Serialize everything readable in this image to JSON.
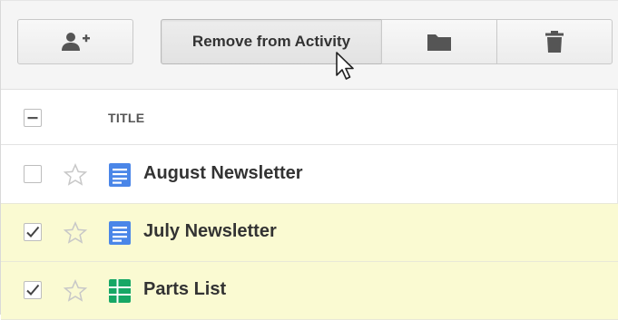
{
  "toolbar": {
    "share_icon": "person-add-icon",
    "remove_label": "Remove from Activity",
    "folder_icon": "folder-icon",
    "trash_icon": "trash-icon"
  },
  "list": {
    "header": {
      "title_label": "TITLE"
    },
    "rows": [
      {
        "name": "August Newsletter",
        "type": "document",
        "selected": false,
        "icon_color": "#4a86e8"
      },
      {
        "name": "July Newsletter",
        "type": "document",
        "selected": true,
        "icon_color": "#4a86e8"
      },
      {
        "name": "Parts List",
        "type": "spreadsheet",
        "selected": true,
        "icon_color": "#16a765"
      }
    ]
  },
  "colors": {
    "selected_row": "#fafad2",
    "doc_blue": "#4a86e8",
    "sheet_green": "#16a765"
  }
}
